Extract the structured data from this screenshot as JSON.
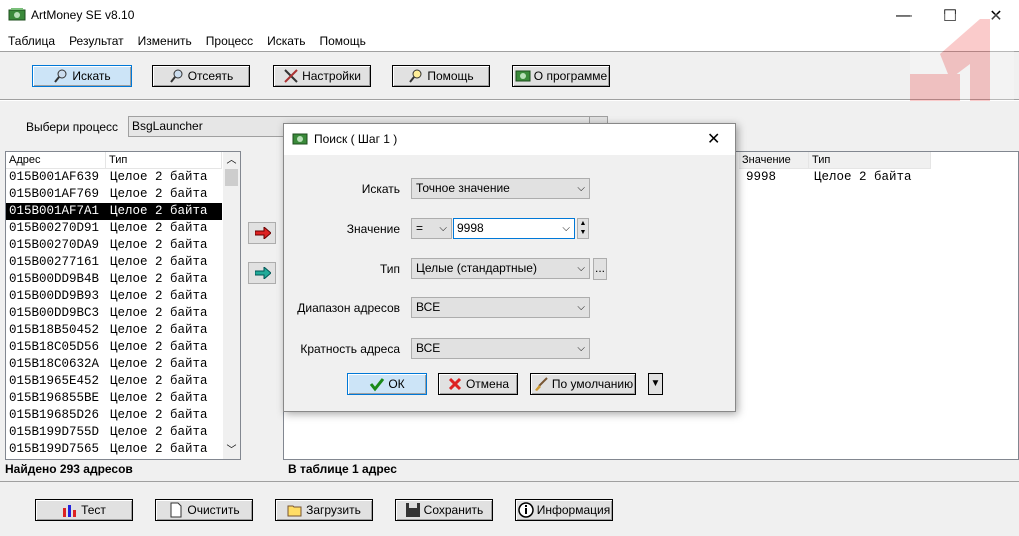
{
  "window": {
    "title": "ArtMoney SE v8.10",
    "minimize": "—",
    "maximize": "☐",
    "close": "✕"
  },
  "menu": [
    "Таблица",
    "Результат",
    "Изменить",
    "Процесс",
    "Искать",
    "Помощь"
  ],
  "toolbar": {
    "search": "Искать",
    "filter": "Отсеять",
    "settings": "Настройки",
    "help": "Помощь",
    "about": "О программе"
  },
  "process": {
    "label": "Выбери процесс",
    "value": "BsgLauncher"
  },
  "left_list": {
    "headers": [
      "Адрес",
      "Тип"
    ],
    "rows": [
      {
        "addr": "015B001AF639",
        "type": "Целое 2 байта"
      },
      {
        "addr": "015B001AF769",
        "type": "Целое 2 байта"
      },
      {
        "addr": "015B001AF7A1",
        "type": "Целое 2 байта"
      },
      {
        "addr": "015B00270D91",
        "type": "Целое 2 байта"
      },
      {
        "addr": "015B00270DA9",
        "type": "Целое 2 байта"
      },
      {
        "addr": "015B00277161",
        "type": "Целое 2 байта"
      },
      {
        "addr": "015B00DD9B4B",
        "type": "Целое 2 байта"
      },
      {
        "addr": "015B00DD9B93",
        "type": "Целое 2 байта"
      },
      {
        "addr": "015B00DD9BC3",
        "type": "Целое 2 байта"
      },
      {
        "addr": "015B18B50452",
        "type": "Целое 2 байта"
      },
      {
        "addr": "015B18C05D56",
        "type": "Целое 2 байта"
      },
      {
        "addr": "015B18C0632A",
        "type": "Целое 2 байта"
      },
      {
        "addr": "015B1965E452",
        "type": "Целое 2 байта"
      },
      {
        "addr": "015B196855BE",
        "type": "Целое 2 байта"
      },
      {
        "addr": "015B19685D26",
        "type": "Целое 2 байта"
      },
      {
        "addr": "015B199D755D",
        "type": "Целое 2 байта"
      },
      {
        "addr": "015B199D7565",
        "type": "Целое 2 байта"
      }
    ],
    "selected_index": 2,
    "status": "Найдено 293 адресов"
  },
  "right_table": {
    "headers": [
      "Значение",
      "Тип"
    ],
    "rows": [
      {
        "value": "9998",
        "type": "Целое 2 байта"
      }
    ],
    "status": "В таблице 1 адрес"
  },
  "bottom": {
    "test": "Тест",
    "clear": "Очистить",
    "load": "Загрузить",
    "save": "Сохранить",
    "info": "Информация"
  },
  "dialog": {
    "title": "Поиск ( Шаг 1 )",
    "search_label": "Искать",
    "search_value": "Точное значение",
    "value_label": "Значение",
    "operator": "=",
    "value": "9998",
    "type_label": "Тип",
    "type_value": "Целые (стандартные)",
    "range_label": "Диапазон адресов",
    "range_value": "ВСЕ",
    "align_label": "Кратность адреса",
    "align_value": "ВСЕ",
    "ok": "ОК",
    "cancel": "Отмена",
    "default": "По умолчанию"
  }
}
